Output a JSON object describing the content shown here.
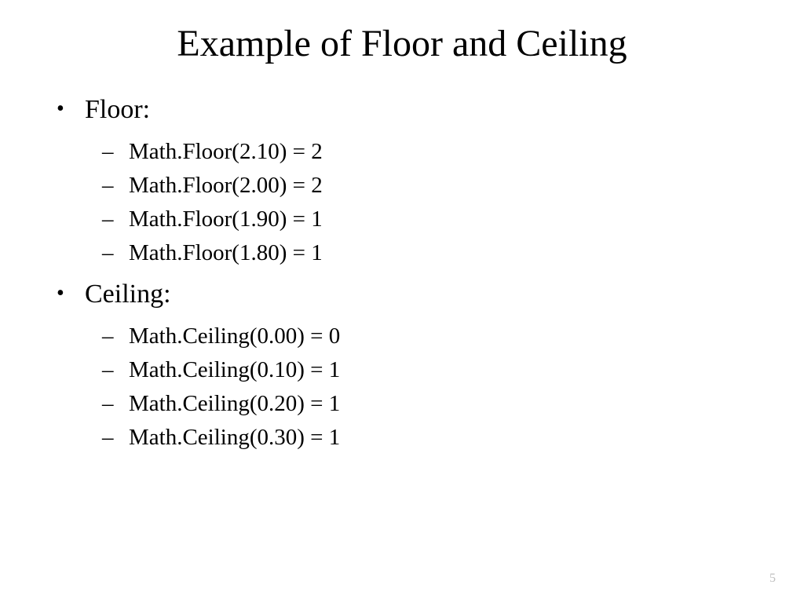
{
  "title": "Example of Floor and Ceiling",
  "sections": [
    {
      "label": "Floor:",
      "items": [
        "Math.Floor(2.10) = 2",
        "Math.Floor(2.00) = 2",
        "Math.Floor(1.90) = 1",
        "Math.Floor(1.80) = 1"
      ]
    },
    {
      "label": "Ceiling:",
      "items": [
        "Math.Ceiling(0.00) = 0",
        "Math.Ceiling(0.10) = 1",
        "Math.Ceiling(0.20) = 1",
        "Math.Ceiling(0.30) = 1"
      ]
    }
  ],
  "page_number": "5"
}
